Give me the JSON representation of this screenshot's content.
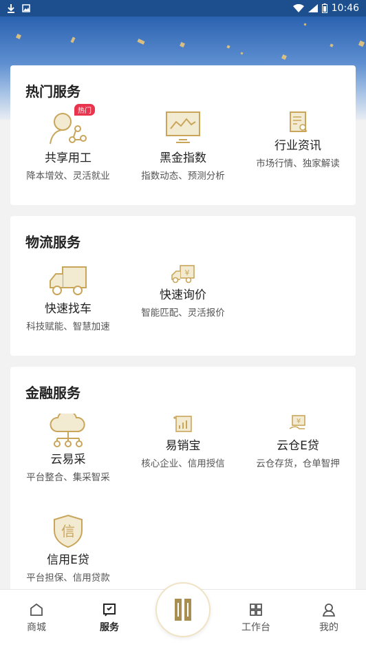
{
  "status_bar": {
    "time": "10:46"
  },
  "sections": [
    {
      "title": "热门服务",
      "items": [
        {
          "name": "共享用工",
          "desc": "降本增效、灵活就业",
          "badge": "热门",
          "icon": "share-people-icon"
        },
        {
          "name": "黑金指数",
          "desc": "指数动态、预测分析",
          "icon": "index-chart-icon"
        },
        {
          "name": "行业资讯",
          "desc": "市场行情、独家解读",
          "icon": "news-document-icon"
        }
      ]
    },
    {
      "title": "物流服务",
      "items": [
        {
          "name": "快速找车",
          "desc": "科技赋能、智慧加速",
          "icon": "truck-icon"
        },
        {
          "name": "快速询价",
          "desc": "智能匹配、灵活报价",
          "icon": "truck-price-icon"
        }
      ]
    },
    {
      "title": "金融服务",
      "items": [
        {
          "name": "云易采",
          "desc": "平台整合、集采智采",
          "icon": "cloud-network-icon"
        },
        {
          "name": "易销宝",
          "desc": "核心企业、信用授信",
          "icon": "sales-chart-icon"
        },
        {
          "name": "云仓E贷",
          "desc": "云仓存货，仓单智押",
          "icon": "warehouse-loan-icon"
        },
        {
          "name": "信用E贷",
          "desc": "平台担保、信用贷款",
          "icon": "credit-shield-icon",
          "icon_char": "信"
        }
      ]
    }
  ],
  "tabbar": {
    "tabs": [
      {
        "label": "商城",
        "icon": "shop-icon"
      },
      {
        "label": "服务",
        "icon": "service-icon",
        "active": true
      },
      {
        "label": "工作台",
        "icon": "workbench-icon"
      },
      {
        "label": "我的",
        "icon": "profile-icon"
      }
    ],
    "center_icon": "brand-logo-icon"
  },
  "colors": {
    "gold": "#c9a55a",
    "gold_light": "#efe3c4",
    "badge": "#e8344d",
    "status_bar": "#1d4f8f"
  }
}
